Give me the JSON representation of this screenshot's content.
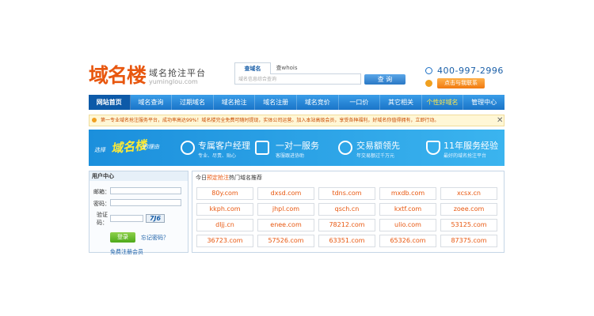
{
  "header": {
    "logo_text": "域名楼",
    "logo_subtitle": "域名抢注平台",
    "logo_url": "yuminglou.com",
    "search_tabs": [
      "查域名",
      "查whois"
    ],
    "search_placeholder": "域名信息综合查询",
    "search_button": "查 询",
    "phone": "400-997-2996",
    "contact_button": "点击与我联系"
  },
  "nav": {
    "items": [
      {
        "label": "网站首页",
        "active": true
      },
      {
        "label": "域名查询"
      },
      {
        "label": "过期域名"
      },
      {
        "label": "域名抢注"
      },
      {
        "label": "域名注册"
      },
      {
        "label": "域名竞价"
      },
      {
        "label": "一口价"
      },
      {
        "label": "其它相关"
      },
      {
        "label": "个性好域名",
        "highlight": true
      },
      {
        "label": "管理中心"
      }
    ]
  },
  "notice": {
    "text": "第一专业域名抢注服务平台，成功率高达99%！域名楼完全免费可随时提现，实体公司运营。加入本站高级会员，享受各种福利，好域名你值得拥有，立即行动。"
  },
  "banner": {
    "slogan_pre": "选择",
    "slogan_main": "域名楼",
    "slogan_post": "的理由",
    "features": [
      {
        "title": "专属客户经理",
        "subtitle": "专业、尽责、贴心",
        "icon": "customer-manager-icon"
      },
      {
        "title": "一对一服务",
        "subtitle": "客服跟进协助",
        "icon": "chat-icon"
      },
      {
        "title": "交易额领先",
        "subtitle": "年交易额过千万元",
        "icon": "yen-icon"
      },
      {
        "title": "11年服务经验",
        "subtitle": "最好的域名抢注平台",
        "icon": "trophy-icon"
      }
    ]
  },
  "user_center": {
    "title": "用户中心",
    "email_label": "邮箱：",
    "password_label": "密码：",
    "captcha_label_1": "验证",
    "captcha_label_2": "码：",
    "captcha_text": "7J6",
    "login_button": "登录",
    "forgot_link": "忘记密码？",
    "register_link": "免费注册会员"
  },
  "domains": {
    "title_pre": "今日",
    "title_highlight": "预定抢注",
    "title_post": "热门域名推荐",
    "items": [
      "80y.com",
      "dxsd.com",
      "tdns.com",
      "mxdb.com",
      "xcsx.cn",
      "kkph.com",
      "jhpl.com",
      "qsch.cn",
      "kxtf.com",
      "zoee.com",
      "dljj.cn",
      "enee.com",
      "78212.com",
      "ulio.com",
      "53125.com",
      "36723.com",
      "57526.com",
      "63351.com",
      "65326.com",
      "87375.com"
    ]
  }
}
